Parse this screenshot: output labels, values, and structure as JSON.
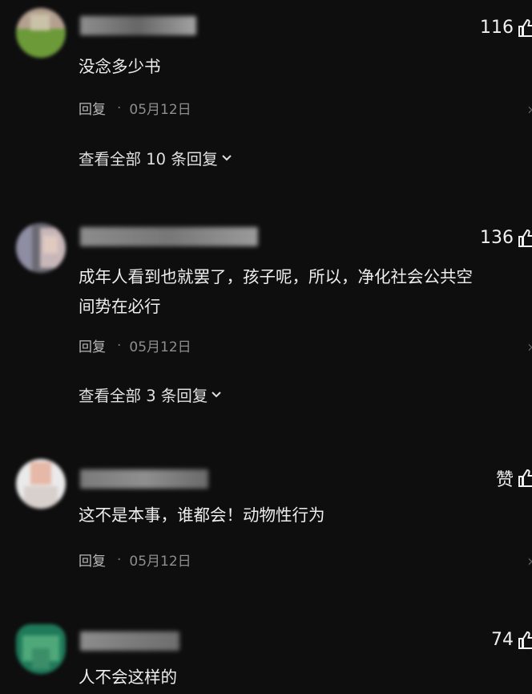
{
  "comments": [
    {
      "avatar_colors": [
        "#b4a090",
        "#6c9a38",
        "#c9c1a8"
      ],
      "username_colors": [
        "#8e8e8e",
        "#666666",
        "#a2a2a2"
      ],
      "likes": "116",
      "text_lines": [
        "没念多少书"
      ],
      "reply_label": "回复",
      "date": "05月12日",
      "view_all": "查看全部 10 条回复"
    },
    {
      "avatar_colors": [
        "#6b6a73",
        "#8e8da2",
        "#c8b7b9"
      ],
      "username_colors": [
        "#8c8c8c",
        "#777777",
        "#9b9b9b"
      ],
      "likes": "136",
      "text_lines": [
        "成年人看到也就罢了，孩子呢，所以，净化社会公共空",
        "间势在必行"
      ],
      "reply_label": "回复",
      "date": "05月12日",
      "view_all": "查看全部 3 条回复"
    },
    {
      "avatar_colors": [
        "#eaeaea",
        "#e6b8a8",
        "#d8d0cc"
      ],
      "username_colors": [
        "#7a7a7a",
        "#8f8f8f",
        "#6a6a6a"
      ],
      "likes": "赞",
      "text_lines": [
        "这不是本事，谁都会！动物性行为"
      ],
      "reply_label": "回复",
      "date": "05月12日",
      "view_all": ""
    },
    {
      "avatar_colors": [
        "#1f7a5a",
        "#4fa87a",
        "#3c8e68"
      ],
      "username_colors": [
        "#8d8d8d",
        "#7c7c7c",
        "#6e6e6e"
      ],
      "likes": "74",
      "text_lines": [
        "人不会这样的"
      ],
      "reply_label": "",
      "date": "",
      "view_all": ""
    }
  ]
}
